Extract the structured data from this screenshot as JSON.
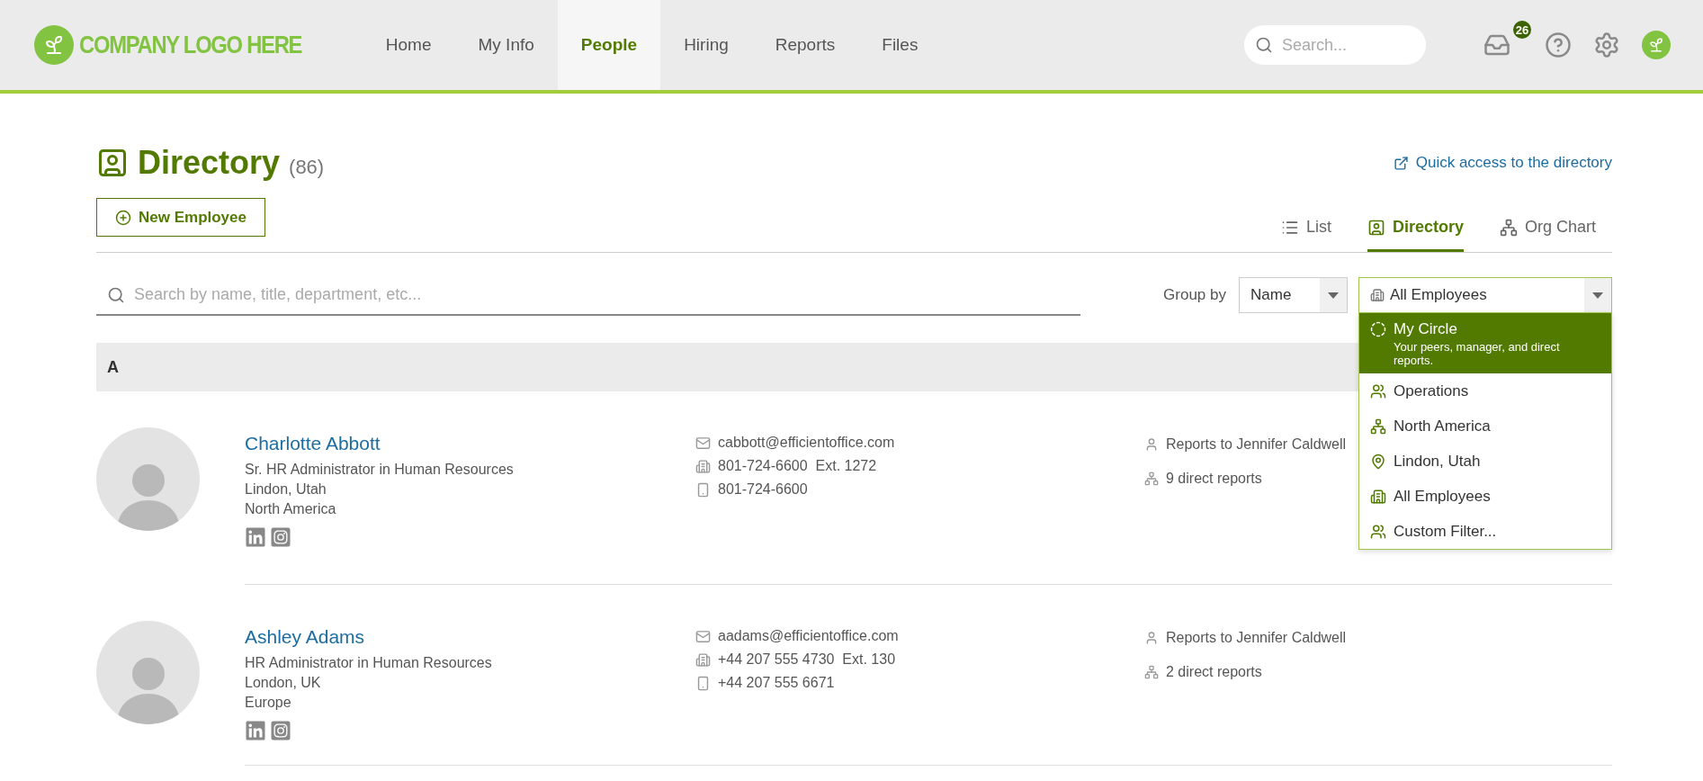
{
  "header": {
    "logo": "COMPANY LOGO HERE",
    "nav": [
      {
        "label": "Home",
        "selected": false
      },
      {
        "label": "My Info",
        "selected": false
      },
      {
        "label": "People",
        "selected": true
      },
      {
        "label": "Hiring",
        "selected": false
      },
      {
        "label": "Reports",
        "selected": false
      },
      {
        "label": "Files",
        "selected": false
      }
    ],
    "search": {
      "placeholder": "Search..."
    },
    "inbox_badge": "26"
  },
  "page": {
    "title": "Directory",
    "count": "(86)",
    "new_button": "New Employee",
    "quick_link": "Quick access to the directory",
    "views": [
      {
        "kind": "list",
        "label": "List",
        "selected": false
      },
      {
        "kind": "directory",
        "label": "Directory",
        "selected": true
      },
      {
        "kind": "org",
        "label": "Org Chart",
        "selected": false
      }
    ],
    "search": {
      "placeholder": "Search by name, title, department, etc..."
    },
    "group_by": {
      "label": "Group by",
      "value": "Name"
    },
    "filter": {
      "value": "All Employees",
      "expanded": true,
      "options": [
        {
          "kind": "circle",
          "label": "My Circle",
          "description": "Your peers, manager, and direct reports.",
          "highlighted": true
        },
        {
          "kind": "people",
          "label": "Operations",
          "highlighted": false
        },
        {
          "kind": "org",
          "label": "North America",
          "highlighted": false
        },
        {
          "kind": "pin",
          "label": "Lindon, Utah",
          "highlighted": false
        },
        {
          "kind": "building",
          "label": "All Employees",
          "highlighted": false
        },
        {
          "kind": "people",
          "label": "Custom Filter...",
          "highlighted": false
        }
      ]
    },
    "group": "A",
    "employees": [
      {
        "name": "Charlotte Abbott",
        "details": [
          "Sr. HR Administrator in Human Resources",
          "Lindon, Utah",
          "North America"
        ],
        "contacts": [
          {
            "kind": "email",
            "text": "cabbott@efficientoffice.com"
          },
          {
            "kind": "phone",
            "text": "801-724-6600  Ext. 1272"
          },
          {
            "kind": "mobile",
            "text": "801-724-6600"
          }
        ],
        "relations": [
          {
            "kind": "manager",
            "text": "Reports to Jennifer Caldwell"
          },
          {
            "kind": "reports",
            "text": "9 direct reports"
          }
        ]
      },
      {
        "name": "Ashley Adams",
        "details": [
          "HR Administrator in Human Resources",
          "London, UK",
          "Europe"
        ],
        "contacts": [
          {
            "kind": "email",
            "text": "aadams@efficientoffice.com"
          },
          {
            "kind": "phone",
            "text": "+44 207 555 4730  Ext. 130"
          },
          {
            "kind": "mobile",
            "text": "+44 207 555 6671"
          }
        ],
        "relations": [
          {
            "kind": "manager",
            "text": "Reports to Jennifer Caldwell"
          },
          {
            "kind": "reports",
            "text": "2 direct reports"
          }
        ]
      }
    ]
  }
}
